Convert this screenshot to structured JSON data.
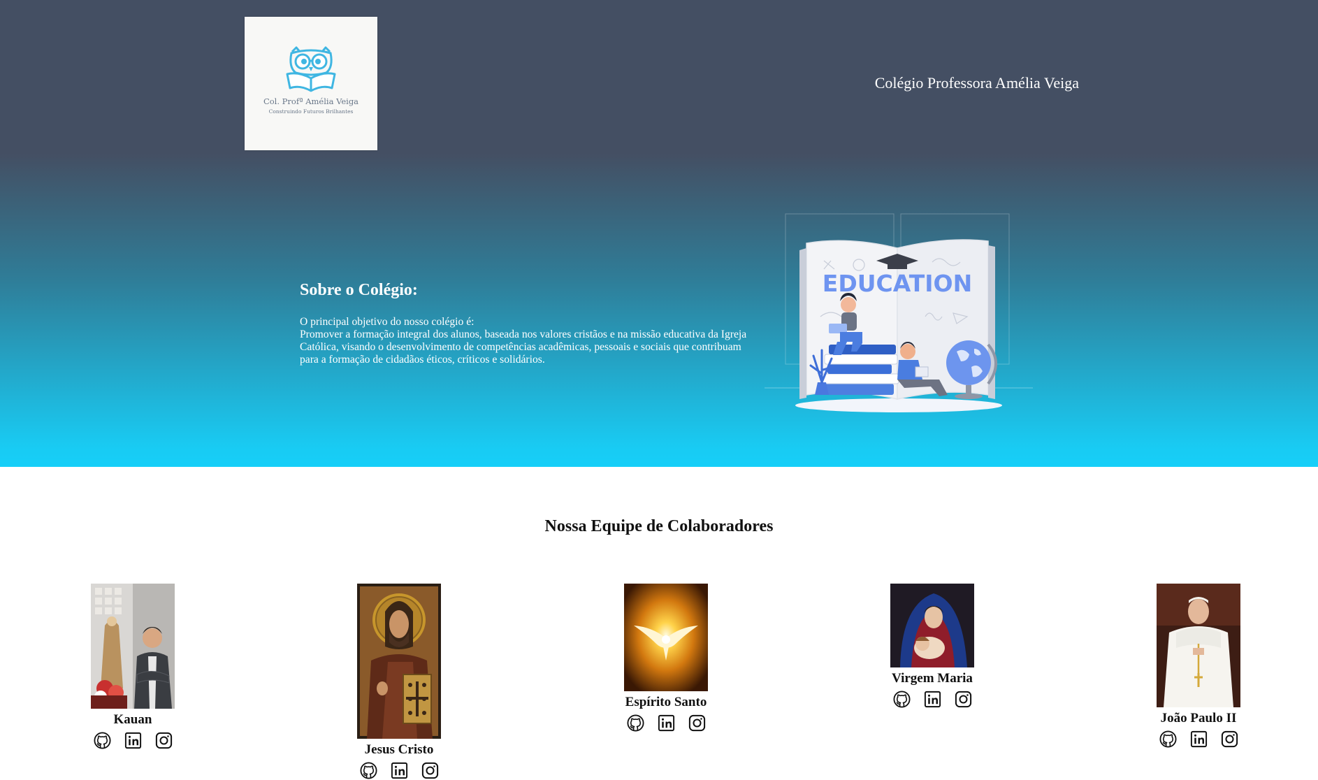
{
  "header": {
    "logo": {
      "name": "Col. Profª Amélia Veiga",
      "tagline": "Construindo Futuros Brilhantes",
      "icon": "owl-reading-book-icon",
      "accent": "#3fb6e2"
    },
    "site_name": "Colégio Professora Amélia Veiga"
  },
  "about": {
    "title": "Sobre o Colégio:",
    "intro": "O principal objetivo do nosso colégio é:",
    "mission": "Promover a formação integral dos alunos, baseada nos valores cristãos e na missão educativa da Igreja Católica, visando o desenvolvimento de competências acadêmicas, pessoais e sociais que contribuam para a formação de cidadãos éticos, críticos e solidários.",
    "illustration_text": "EDUCATION"
  },
  "team": {
    "title": "Nossa Equipe de Colaboradores",
    "members": [
      {
        "name": "Kauan",
        "icons": [
          "github-icon",
          "linkedin-icon",
          "instagram-icon"
        ]
      },
      {
        "name": "Jesus Cristo",
        "icons": [
          "github-icon",
          "linkedin-icon",
          "instagram-icon"
        ]
      },
      {
        "name": "Espírito Santo",
        "icons": [
          "github-icon",
          "linkedin-icon",
          "instagram-icon"
        ]
      },
      {
        "name": "Virgem Maria",
        "icons": [
          "github-icon",
          "linkedin-icon",
          "instagram-icon"
        ]
      },
      {
        "name": "João Paulo II",
        "icons": [
          "github-icon",
          "linkedin-icon",
          "instagram-icon"
        ]
      }
    ]
  },
  "colors": {
    "hero_top": "#444f63",
    "hero_bottom": "#16cff8",
    "text_light": "#ffffff",
    "text_dark": "#111111"
  }
}
